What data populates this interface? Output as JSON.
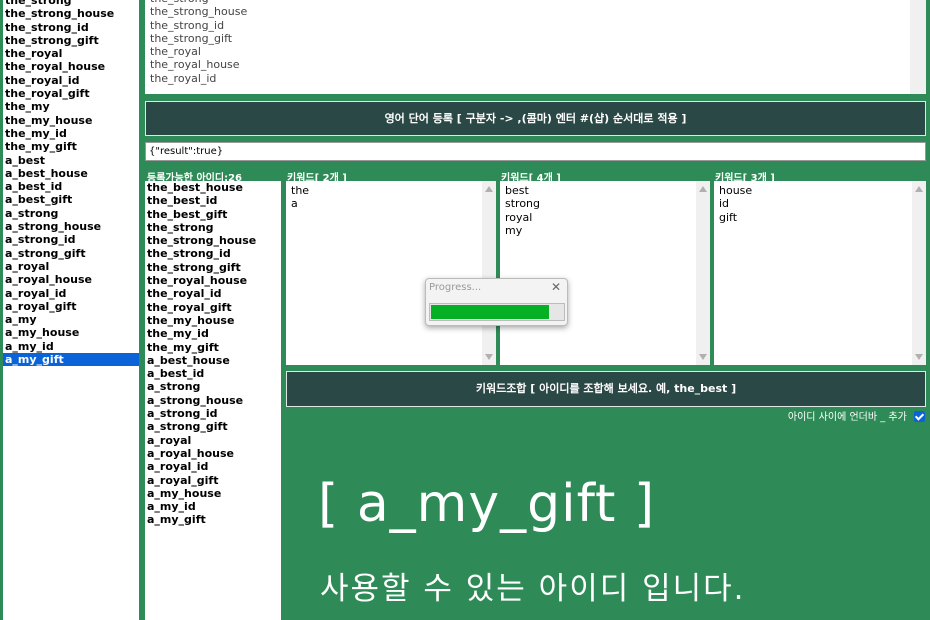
{
  "left_list": {
    "items": [
      "the_strong",
      "the_strong_house",
      "the_strong_id",
      "the_strong_gift",
      "the_royal",
      "the_royal_house",
      "the_royal_id",
      "the_royal_gift",
      "the_my",
      "the_my_house",
      "the_my_id",
      "the_my_gift",
      "a_best",
      "a_best_house",
      "a_best_id",
      "a_best_gift",
      "a_strong",
      "a_strong_house",
      "a_strong_id",
      "a_strong_gift",
      "a_royal",
      "a_royal_house",
      "a_royal_id",
      "a_royal_gift",
      "a_my",
      "a_my_house",
      "a_my_id",
      "a_my_gift"
    ],
    "selected": "a_my_gift"
  },
  "preview_list": {
    "items": [
      "the_strong",
      "the_strong_house",
      "the_strong_id",
      "the_strong_gift",
      "the_royal",
      "the_royal_house",
      "the_royal_id"
    ]
  },
  "register_button": "영어 단어 등록 [ 구분자 -> ,(콤마) 엔터  #(샵) 순서대로 적용 ]",
  "result_field": {
    "value": "{\"result\":true}"
  },
  "available": {
    "label": "등록가능한 아이디:26",
    "items": [
      "the_best_house",
      "the_best_id",
      "the_best_gift",
      "the_strong",
      "the_strong_house",
      "the_strong_id",
      "the_strong_gift",
      "the_royal_house",
      "the_royal_id",
      "the_royal_gift",
      "the_my_house",
      "the_my_id",
      "the_my_gift",
      "a_best_house",
      "a_best_id",
      "a_strong",
      "a_strong_house",
      "a_strong_id",
      "a_strong_gift",
      "a_royal",
      "a_royal_house",
      "a_royal_id",
      "a_royal_gift",
      "a_my_house",
      "a_my_id",
      "a_my_gift"
    ]
  },
  "keywords": [
    {
      "label": "키워드[ 2개 ]",
      "items": [
        "the",
        "a"
      ]
    },
    {
      "label": "키워드[ 4개 ]",
      "items": [
        "best",
        "strong",
        "royal",
        "my"
      ]
    },
    {
      "label": "키워드[ 3개 ]",
      "items": [
        "house",
        "id",
        "gift"
      ]
    }
  ],
  "combine_button": "키워드조합 [ 아이디를 조합해 보세요. 예, the_best ]",
  "underscore_option": {
    "label": "아이디 사이에 언더바 _ 추가",
    "checked": true
  },
  "progress_dialog": {
    "title": "Progress...",
    "close_glyph": "✕",
    "progress_percent": 90
  },
  "big_result": {
    "id_text": "[ a_my_gift ]",
    "message": "사용할 수 있는 아이디 입니다."
  },
  "colors": {
    "background": "#2e8b57",
    "button": "#2a4845",
    "selection": "#0a64d7",
    "progress": "#06b025"
  }
}
